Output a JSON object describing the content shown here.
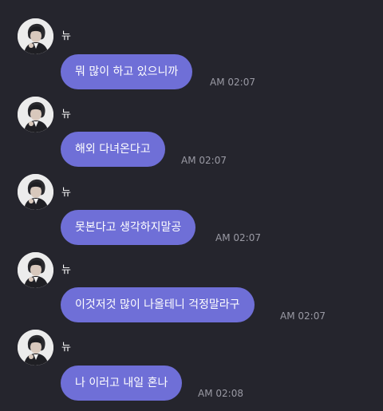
{
  "messages": [
    {
      "sender": "뉴",
      "text": "뭐 많이 하고 있으니까",
      "time": "AM 02:07"
    },
    {
      "sender": "뉴",
      "text": "해외 다녀온다고",
      "time": "AM 02:07"
    },
    {
      "sender": "뉴",
      "text": "못본다고 생각하지말공",
      "time": "AM 02:07"
    },
    {
      "sender": "뉴",
      "text": "이것저것 많이 나올테니 걱정말라구",
      "time": "AM 02:07"
    },
    {
      "sender": "뉴",
      "text": "나 이러고 내일 혼나",
      "time": "AM 02:08"
    }
  ],
  "theme": {
    "background": "#25252d",
    "bubble": "#6f6fd7",
    "timestamp": "#9a9aa4"
  },
  "avatar_icon": "profile-photo"
}
